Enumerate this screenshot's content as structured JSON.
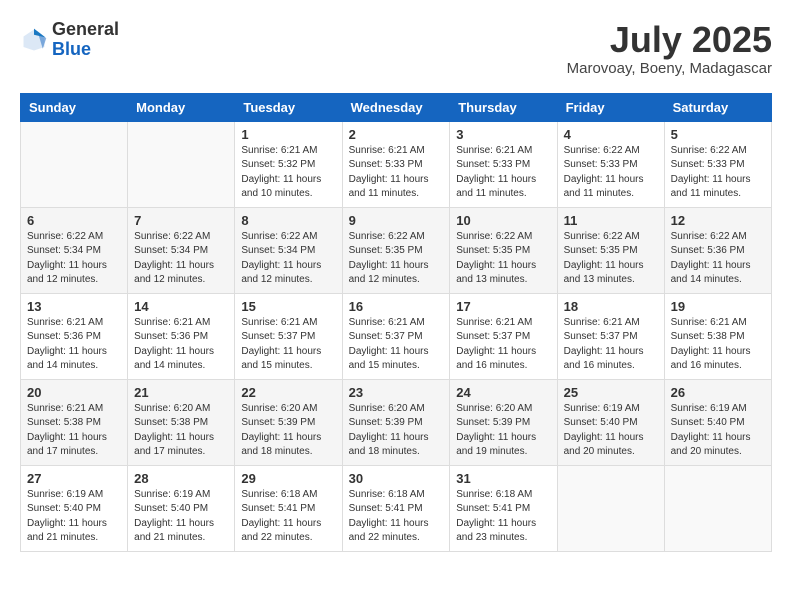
{
  "header": {
    "logo": {
      "line1": "General",
      "line2": "Blue"
    },
    "title": "July 2025",
    "subtitle": "Marovoay, Boeny, Madagascar"
  },
  "weekdays": [
    "Sunday",
    "Monday",
    "Tuesday",
    "Wednesday",
    "Thursday",
    "Friday",
    "Saturday"
  ],
  "weeks": [
    [
      {
        "day": "",
        "info": ""
      },
      {
        "day": "",
        "info": ""
      },
      {
        "day": "1",
        "info": "Sunrise: 6:21 AM\nSunset: 5:32 PM\nDaylight: 11 hours and 10 minutes."
      },
      {
        "day": "2",
        "info": "Sunrise: 6:21 AM\nSunset: 5:33 PM\nDaylight: 11 hours and 11 minutes."
      },
      {
        "day": "3",
        "info": "Sunrise: 6:21 AM\nSunset: 5:33 PM\nDaylight: 11 hours and 11 minutes."
      },
      {
        "day": "4",
        "info": "Sunrise: 6:22 AM\nSunset: 5:33 PM\nDaylight: 11 hours and 11 minutes."
      },
      {
        "day": "5",
        "info": "Sunrise: 6:22 AM\nSunset: 5:33 PM\nDaylight: 11 hours and 11 minutes."
      }
    ],
    [
      {
        "day": "6",
        "info": "Sunrise: 6:22 AM\nSunset: 5:34 PM\nDaylight: 11 hours and 12 minutes."
      },
      {
        "day": "7",
        "info": "Sunrise: 6:22 AM\nSunset: 5:34 PM\nDaylight: 11 hours and 12 minutes."
      },
      {
        "day": "8",
        "info": "Sunrise: 6:22 AM\nSunset: 5:34 PM\nDaylight: 11 hours and 12 minutes."
      },
      {
        "day": "9",
        "info": "Sunrise: 6:22 AM\nSunset: 5:35 PM\nDaylight: 11 hours and 12 minutes."
      },
      {
        "day": "10",
        "info": "Sunrise: 6:22 AM\nSunset: 5:35 PM\nDaylight: 11 hours and 13 minutes."
      },
      {
        "day": "11",
        "info": "Sunrise: 6:22 AM\nSunset: 5:35 PM\nDaylight: 11 hours and 13 minutes."
      },
      {
        "day": "12",
        "info": "Sunrise: 6:22 AM\nSunset: 5:36 PM\nDaylight: 11 hours and 14 minutes."
      }
    ],
    [
      {
        "day": "13",
        "info": "Sunrise: 6:21 AM\nSunset: 5:36 PM\nDaylight: 11 hours and 14 minutes."
      },
      {
        "day": "14",
        "info": "Sunrise: 6:21 AM\nSunset: 5:36 PM\nDaylight: 11 hours and 14 minutes."
      },
      {
        "day": "15",
        "info": "Sunrise: 6:21 AM\nSunset: 5:37 PM\nDaylight: 11 hours and 15 minutes."
      },
      {
        "day": "16",
        "info": "Sunrise: 6:21 AM\nSunset: 5:37 PM\nDaylight: 11 hours and 15 minutes."
      },
      {
        "day": "17",
        "info": "Sunrise: 6:21 AM\nSunset: 5:37 PM\nDaylight: 11 hours and 16 minutes."
      },
      {
        "day": "18",
        "info": "Sunrise: 6:21 AM\nSunset: 5:37 PM\nDaylight: 11 hours and 16 minutes."
      },
      {
        "day": "19",
        "info": "Sunrise: 6:21 AM\nSunset: 5:38 PM\nDaylight: 11 hours and 16 minutes."
      }
    ],
    [
      {
        "day": "20",
        "info": "Sunrise: 6:21 AM\nSunset: 5:38 PM\nDaylight: 11 hours and 17 minutes."
      },
      {
        "day": "21",
        "info": "Sunrise: 6:20 AM\nSunset: 5:38 PM\nDaylight: 11 hours and 17 minutes."
      },
      {
        "day": "22",
        "info": "Sunrise: 6:20 AM\nSunset: 5:39 PM\nDaylight: 11 hours and 18 minutes."
      },
      {
        "day": "23",
        "info": "Sunrise: 6:20 AM\nSunset: 5:39 PM\nDaylight: 11 hours and 18 minutes."
      },
      {
        "day": "24",
        "info": "Sunrise: 6:20 AM\nSunset: 5:39 PM\nDaylight: 11 hours and 19 minutes."
      },
      {
        "day": "25",
        "info": "Sunrise: 6:19 AM\nSunset: 5:40 PM\nDaylight: 11 hours and 20 minutes."
      },
      {
        "day": "26",
        "info": "Sunrise: 6:19 AM\nSunset: 5:40 PM\nDaylight: 11 hours and 20 minutes."
      }
    ],
    [
      {
        "day": "27",
        "info": "Sunrise: 6:19 AM\nSunset: 5:40 PM\nDaylight: 11 hours and 21 minutes."
      },
      {
        "day": "28",
        "info": "Sunrise: 6:19 AM\nSunset: 5:40 PM\nDaylight: 11 hours and 21 minutes."
      },
      {
        "day": "29",
        "info": "Sunrise: 6:18 AM\nSunset: 5:41 PM\nDaylight: 11 hours and 22 minutes."
      },
      {
        "day": "30",
        "info": "Sunrise: 6:18 AM\nSunset: 5:41 PM\nDaylight: 11 hours and 22 minutes."
      },
      {
        "day": "31",
        "info": "Sunrise: 6:18 AM\nSunset: 5:41 PM\nDaylight: 11 hours and 23 minutes."
      },
      {
        "day": "",
        "info": ""
      },
      {
        "day": "",
        "info": ""
      }
    ]
  ]
}
